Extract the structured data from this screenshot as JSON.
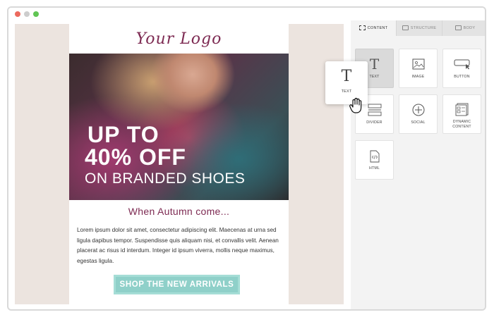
{
  "email": {
    "logo_text": "Your Logo",
    "hero_line1": "UP TO",
    "hero_line2": "40% OFF",
    "hero_line3": "ON BRANDED SHOES",
    "heading": "When Autumn come...",
    "body": "Lorem ipsum dolor sit amet, consectetur adipiscing elit. Maecenas at urna sed ligula dapibus tempor. Suspendisse quis aliquam nisi, et convallis velit. Aenean placerat ac risus id interdum. Integer id ipsum viverra, mollis neque maximus, egestas ligula.",
    "cta_label": "SHOP THE NEW ARRIVALS"
  },
  "panel": {
    "tabs": [
      {
        "label": "CONTENT",
        "icon": "grid-icon",
        "active": true
      },
      {
        "label": "STRUCTURE",
        "icon": "rows-icon",
        "active": false
      },
      {
        "label": "BODY",
        "icon": "window-icon",
        "active": false
      }
    ],
    "blocks": [
      {
        "label": "TEXT",
        "icon": "text-icon"
      },
      {
        "label": "IMAGE",
        "icon": "image-icon"
      },
      {
        "label": "BUTTON",
        "icon": "button-icon"
      },
      {
        "label": "DIVIDER",
        "icon": "divider-icon"
      },
      {
        "label": "SOCIAL",
        "icon": "plus-circle-icon"
      },
      {
        "label": "DYNAMIC CONTENT",
        "icon": "dynamic-content-icon"
      },
      {
        "label": "HTML",
        "icon": "html-file-icon"
      }
    ]
  },
  "drag": {
    "glyph": "T",
    "label": "TEXT"
  },
  "colors": {
    "brand": "#7d2a52",
    "cta": "#8fd0c9",
    "canvas_bg": "#ece4df"
  }
}
